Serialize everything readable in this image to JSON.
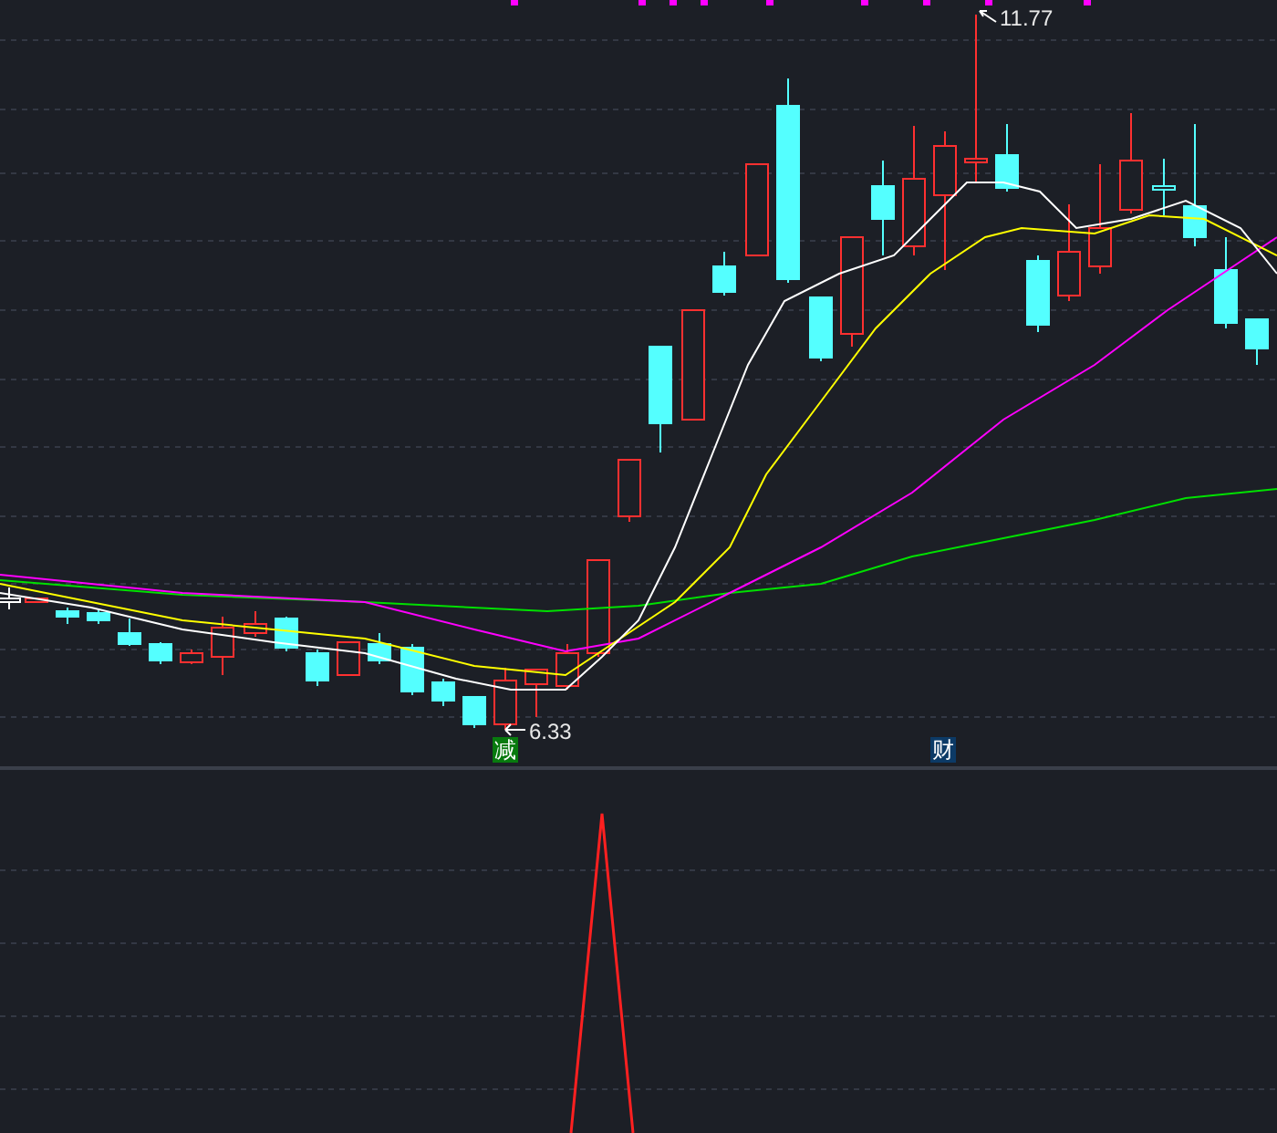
{
  "chart": {
    "high_label": "11.77",
    "low_label": "6.33",
    "signals": [
      {
        "text": "减",
        "color": "#087a0e"
      },
      {
        "text": "财",
        "color": "#0c3a66"
      }
    ]
  }
}
